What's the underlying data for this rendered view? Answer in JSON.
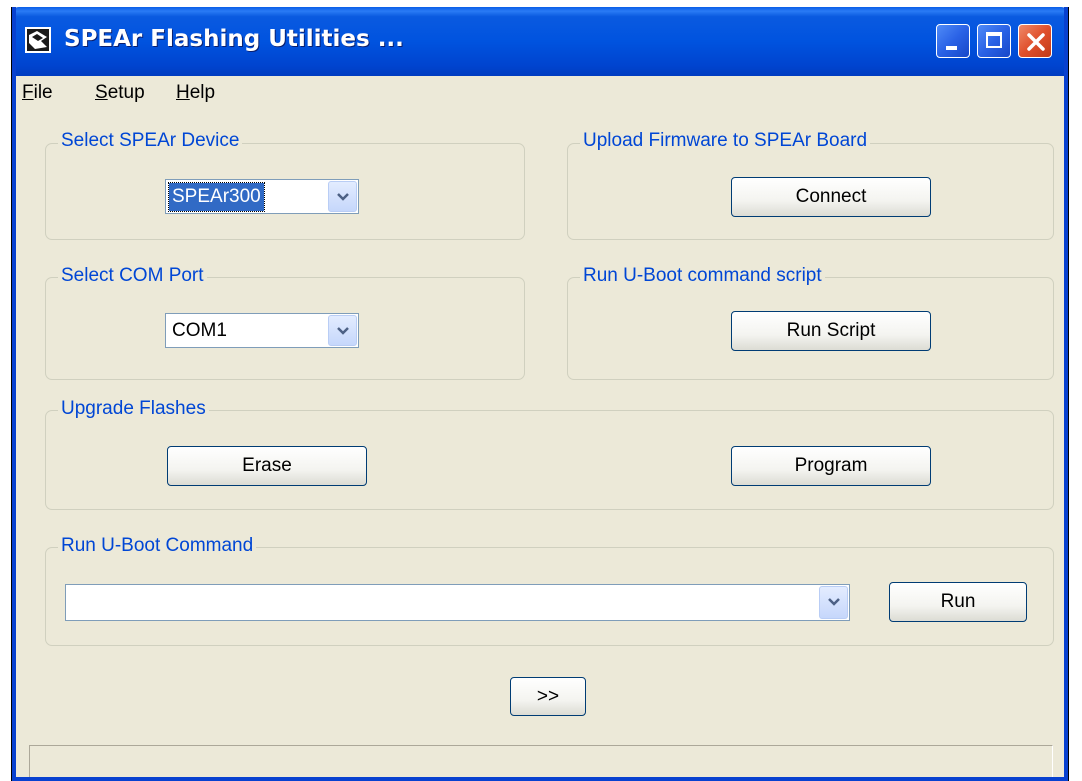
{
  "window": {
    "title": "SPEAr Flashing Utilities ...",
    "icon": "spear-app-icon",
    "controls": [
      "minimize-icon",
      "maximize-icon",
      "close-icon"
    ]
  },
  "menu": [
    {
      "accel": "F",
      "rest": "ile"
    },
    {
      "accel": "S",
      "rest": "etup"
    },
    {
      "accel": "H",
      "rest": "elp"
    }
  ],
  "device_group": {
    "label": "Select SPEAr Device",
    "selected": "SPEAr300"
  },
  "com_group": {
    "label": "Select COM Port",
    "selected": "COM1"
  },
  "upload_group": {
    "label": "Upload Firmware to SPEAr Board",
    "connect_label": "Connect"
  },
  "script_group": {
    "label": "Run U-Boot command script",
    "run_script_label": "Run Script"
  },
  "flash_group": {
    "label": "Upgrade Flashes",
    "erase_label": "Erase",
    "program_label": "Program"
  },
  "command_group": {
    "label": "Run U-Boot Command",
    "command_value": "",
    "run_label": "Run"
  },
  "expand_label": ">>",
  "status_text": "",
  "colors": {
    "titlebar": "#0053df",
    "group_label": "#0046d5",
    "window_bg": "#ece9d8",
    "selection": "#316ac5"
  }
}
